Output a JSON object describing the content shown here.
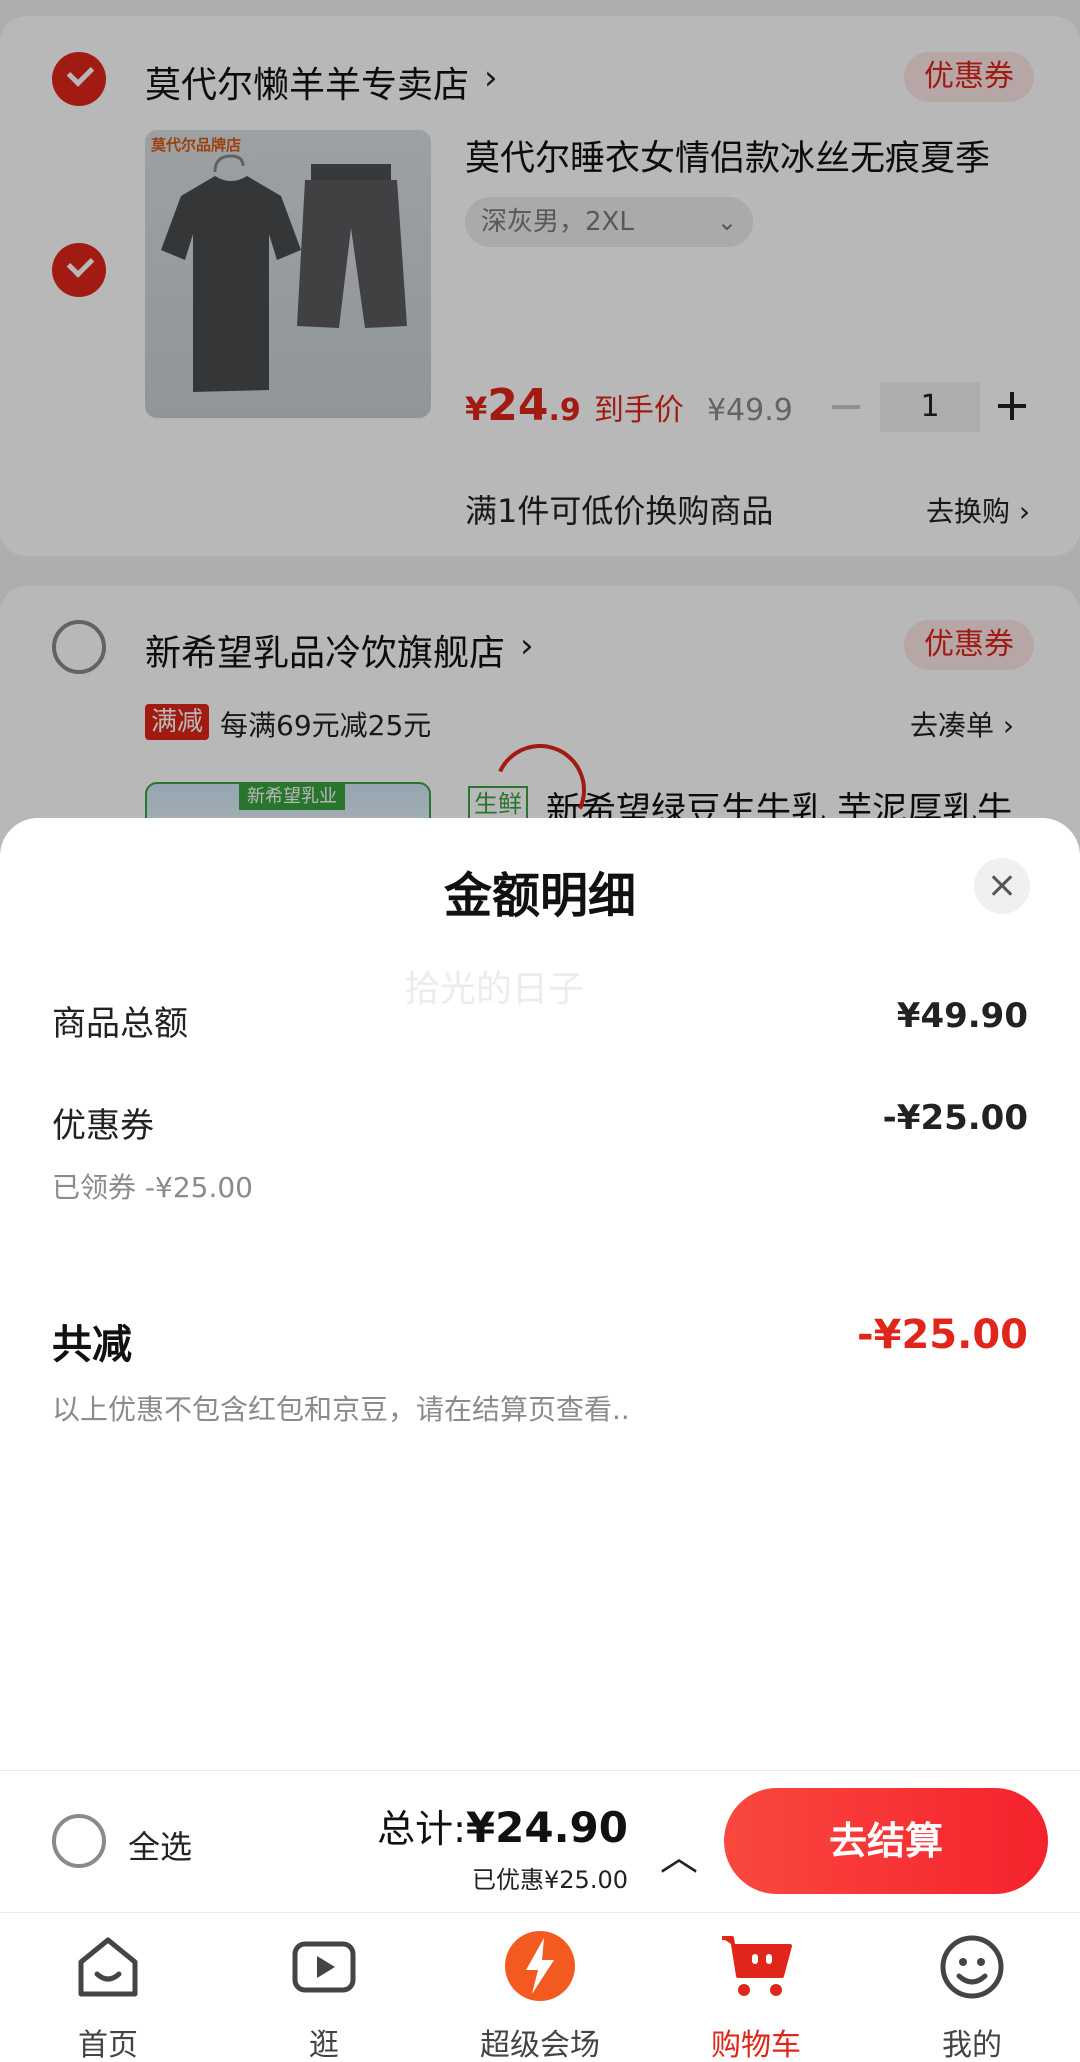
{
  "store1": {
    "name": "莫代尔懒羊羊专卖店",
    "coupon_label": "优惠券",
    "product": {
      "title": "莫代尔睡衣女情侣款冰丝无痕夏季",
      "thumb_logo": "莫代尔品牌店",
      "spec": "深灰男，2XL",
      "price_symbol": "¥",
      "price_int": "24",
      "price_dec": ".9",
      "price_label": "到手价",
      "orig_price": "¥49.9",
      "quantity": "1"
    },
    "promo_text": "满1件可低价换购商品",
    "promo_link": "去换购"
  },
  "store2": {
    "name": "新希望乳品冷饮旗舰店",
    "coupon_label": "优惠券",
    "promo_tag": "满减",
    "promo_text": "每满69元减25元",
    "promo_link": "去凑单",
    "product": {
      "fresh_tag": "生鲜",
      "title": "新希望绿豆生牛乳 芋泥厚乳牛",
      "thumb_text": "新希望乳业"
    }
  },
  "sheet": {
    "title": "金额明细",
    "watermark": "拾光的日子",
    "rows": [
      {
        "label": "商品总额",
        "value": "¥49.90"
      },
      {
        "label": "优惠券",
        "value": "-¥25.00",
        "sub": "已领券 -¥25.00"
      }
    ],
    "total_label": "共减",
    "total_value": "-¥25.00",
    "note": "以上优惠不包含红包和京豆，请在结算页查看.."
  },
  "bottom_bar": {
    "select_all": "全选",
    "total_label": "总计:",
    "total_value": "¥24.90",
    "discount": "已优惠¥25.00",
    "checkout": "去结算"
  },
  "tabs": [
    {
      "label": "首页",
      "icon": "home-icon"
    },
    {
      "label": "逛",
      "icon": "video-icon"
    },
    {
      "label": "超级会场",
      "icon": "super-venue-icon"
    },
    {
      "label": "购物车",
      "icon": "cart-icon",
      "active": true
    },
    {
      "label": "我的",
      "icon": "profile-icon"
    }
  ],
  "colors": {
    "accent": "#e0261b",
    "checkout": "#f5222d"
  }
}
